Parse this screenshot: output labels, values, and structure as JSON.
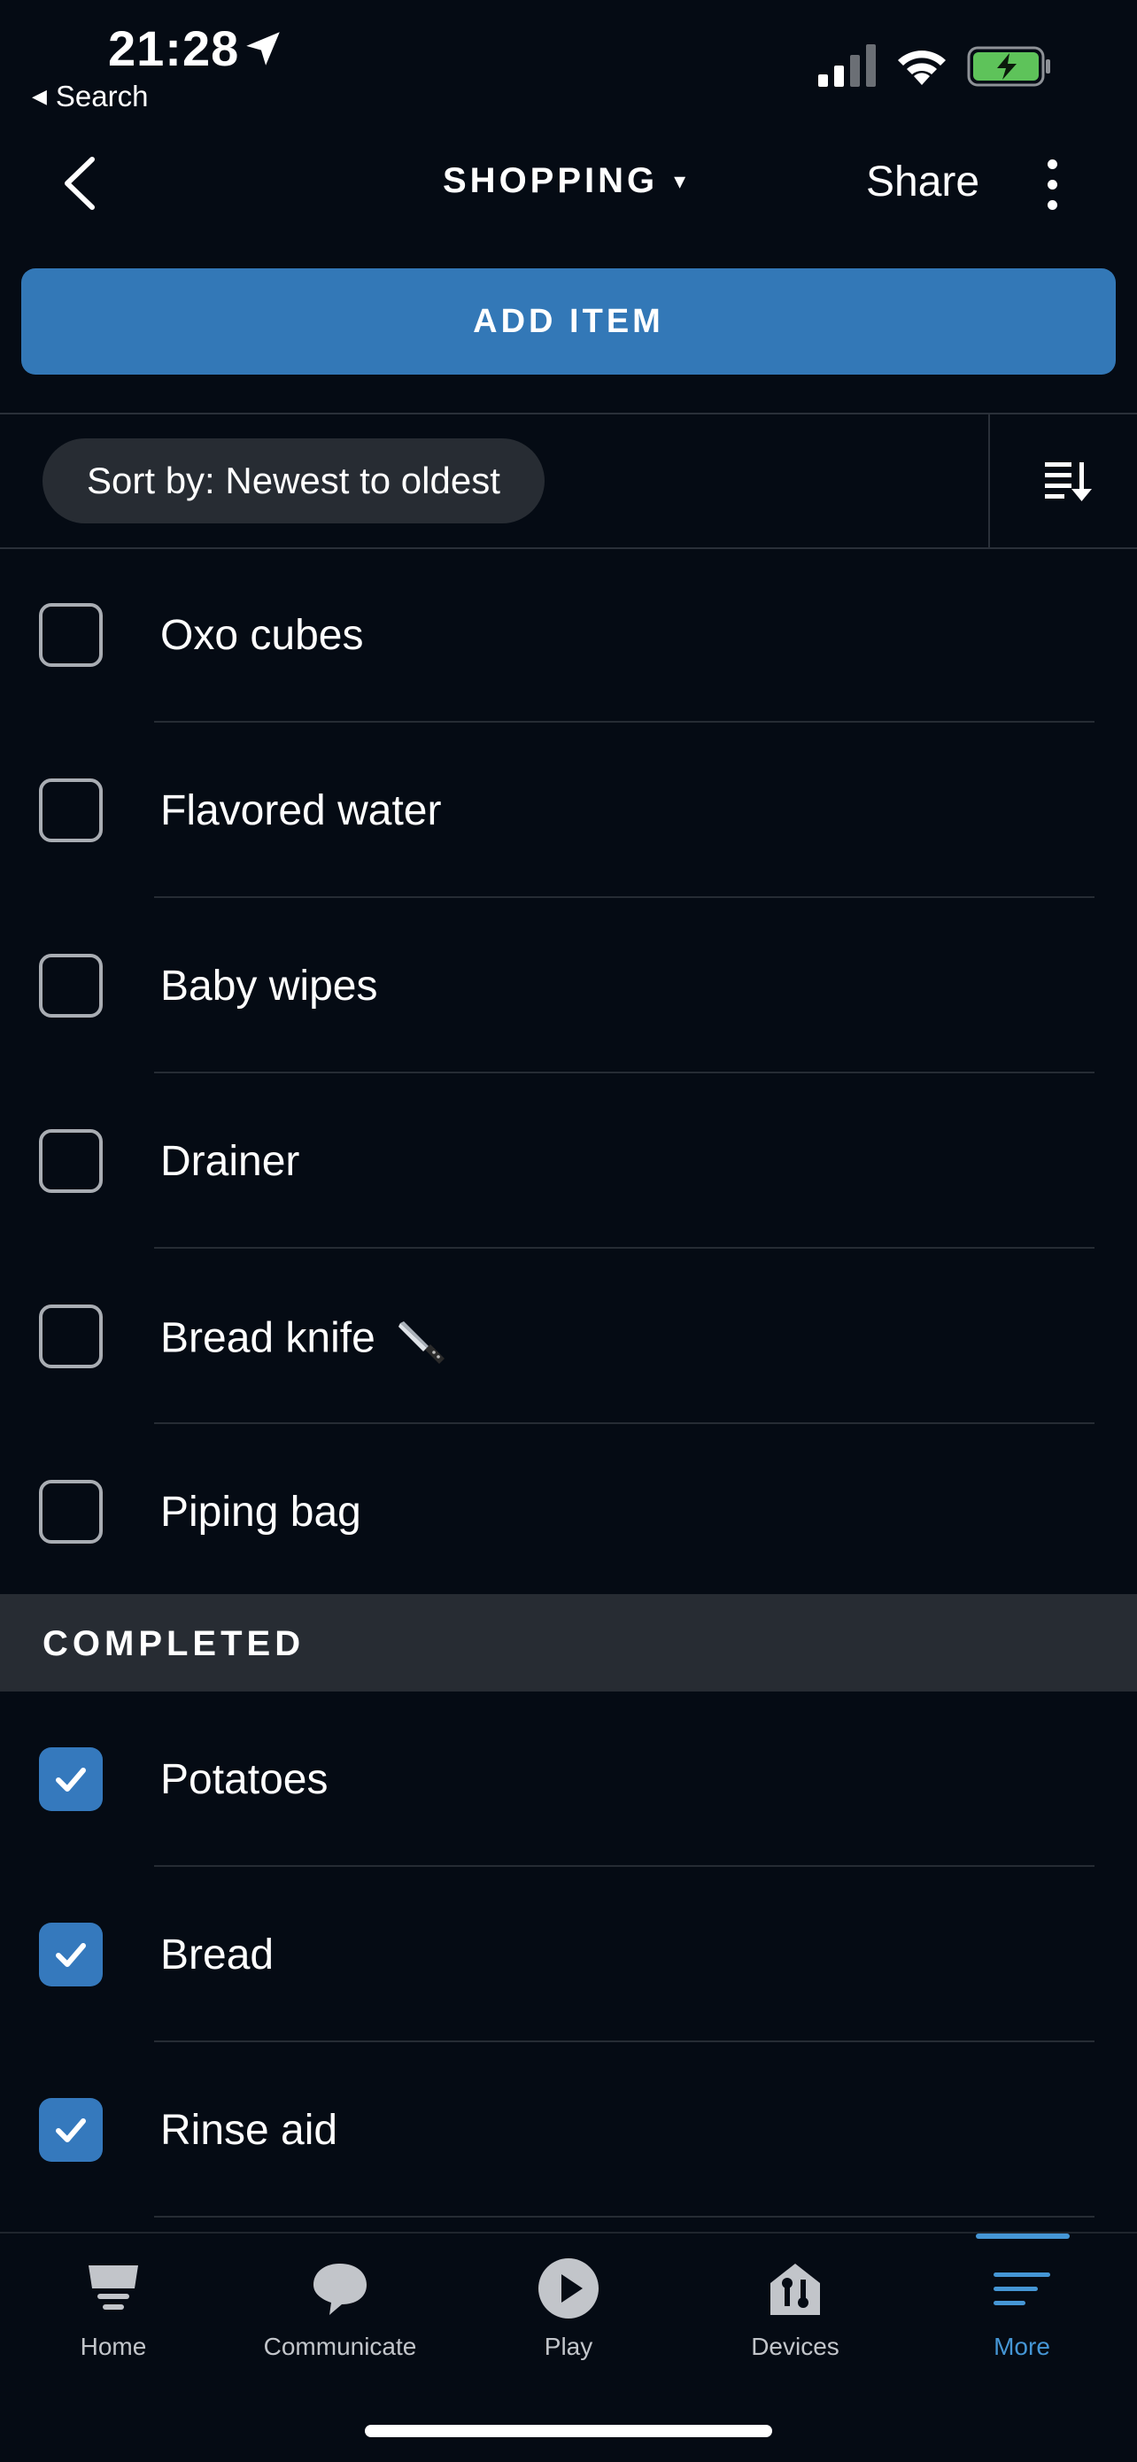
{
  "status_bar": {
    "time": "21:28",
    "back_app_label": "Search"
  },
  "nav": {
    "title": "SHOPPING",
    "title_caret": "▾",
    "share_label": "Share"
  },
  "add_item_label": "ADD ITEM",
  "sort": {
    "label": "Sort by: Newest to oldest"
  },
  "items": [
    {
      "label": "Oxo cubes",
      "checked": false
    },
    {
      "label": "Flavored water",
      "checked": false
    },
    {
      "label": "Baby wipes",
      "checked": false
    },
    {
      "label": "Drainer",
      "checked": false
    },
    {
      "label": "Bread knife",
      "checked": false,
      "emoji_icon": "knife-emoji-icon"
    },
    {
      "label": "Piping bag",
      "checked": false
    }
  ],
  "completed_header": "COMPLETED",
  "completed_items": [
    {
      "label": "Potatoes",
      "checked": true
    },
    {
      "label": "Bread",
      "checked": true
    },
    {
      "label": "Rinse aid",
      "checked": true
    }
  ],
  "tabs": [
    {
      "label": "Home",
      "icon": "home-icon",
      "active": false
    },
    {
      "label": "Communicate",
      "icon": "chat-bubble-icon",
      "active": false
    },
    {
      "label": "Play",
      "icon": "play-icon",
      "active": false
    },
    {
      "label": "Devices",
      "icon": "devices-house-icon",
      "active": false
    },
    {
      "label": "More",
      "icon": "menu-lines-icon",
      "active": true
    }
  ],
  "colors": {
    "background": "#050b14",
    "accent_blue": "#3378b7",
    "active_tab": "#4596d5",
    "checked_box": "#3579bd",
    "section_header": "#272c33"
  }
}
